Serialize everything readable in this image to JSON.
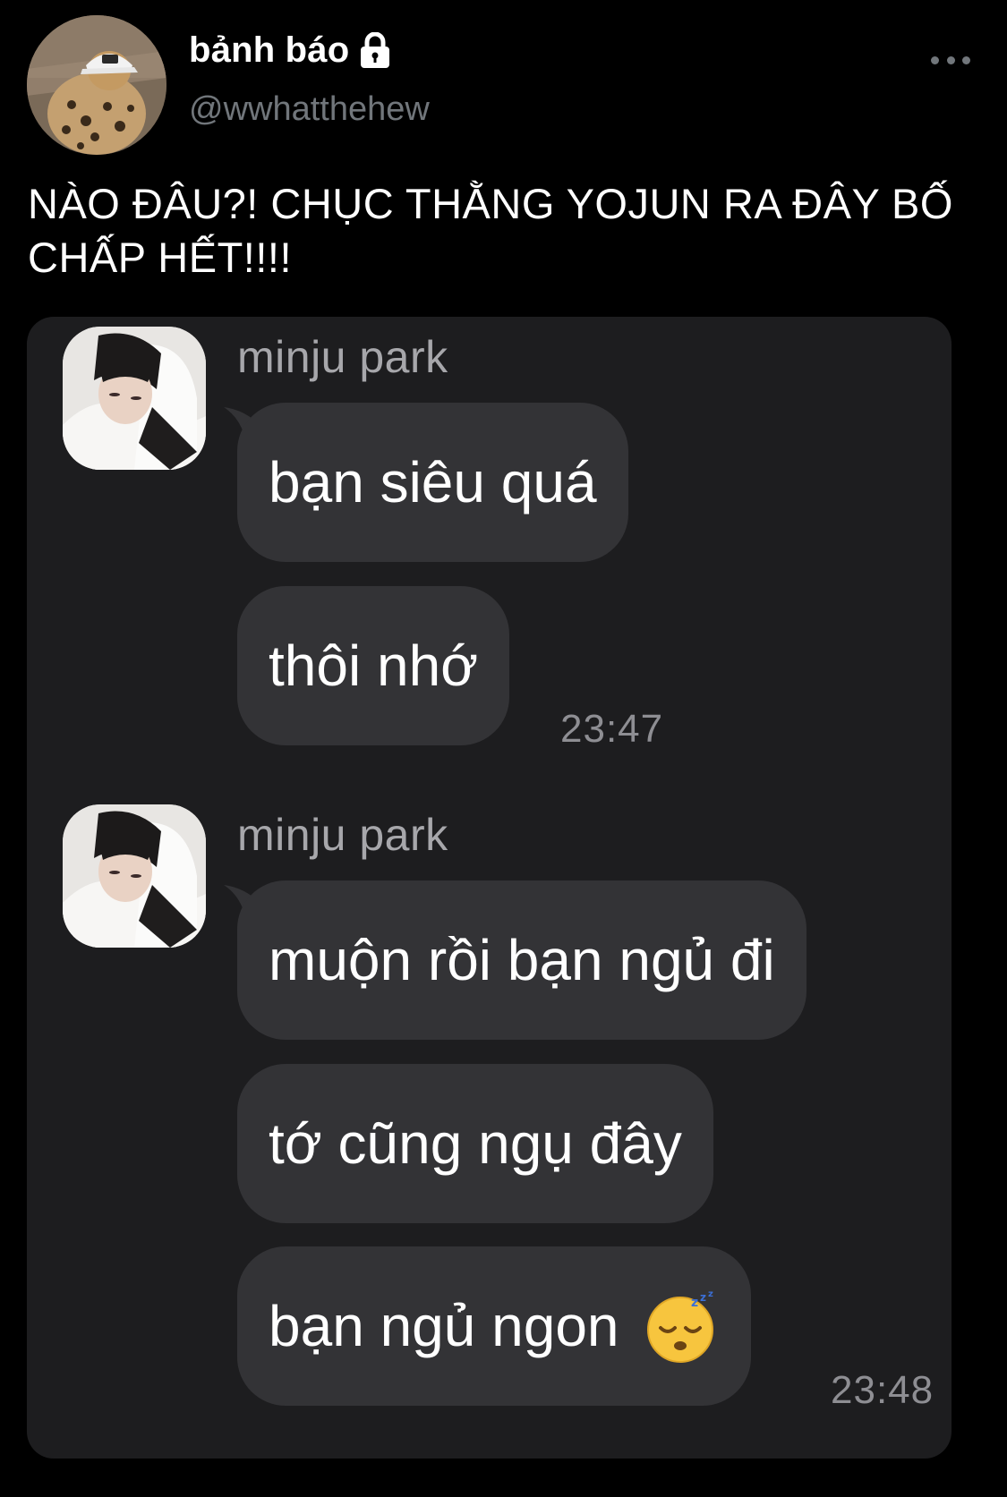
{
  "tweet": {
    "display_name": "bảnh báo",
    "handle": "@wwhatthehew",
    "text": "NÀO ĐÂU?! CHỤC THẰNG YOJUN RA ĐÂY BỐ CHẤP HẾT!!!!",
    "lock_icon": "lock-icon",
    "more_icon": "more-horizontal-icon"
  },
  "chat": {
    "groups": [
      {
        "sender": "minju park",
        "messages": [
          "bạn siêu quá",
          "thôi nhớ"
        ],
        "time": "23:47"
      },
      {
        "sender": "minju park",
        "messages": [
          "muộn rồi bạn ngủ đi",
          "tớ cũng ngụ đây",
          "bạn ngủ ngon"
        ],
        "time": "23:48",
        "last_message_emoji": "sleeping-face-emoji"
      }
    ]
  },
  "colors": {
    "background": "#000000",
    "secondary_text": "#71767b",
    "media_background": "#1d1d1f",
    "bubble": "#333336",
    "sender_name": "#a7a7ab",
    "timestamp": "#8e8e93"
  }
}
